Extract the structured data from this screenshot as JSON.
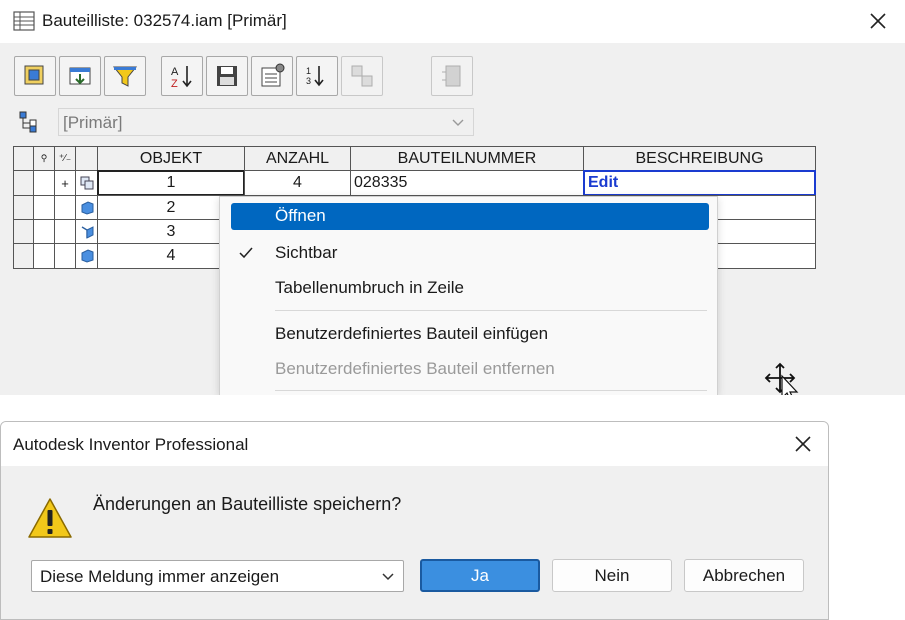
{
  "bom_window": {
    "title": "Bauteilliste: 032574.iam [Primär]",
    "toolbar": [
      {
        "icon": "view-options-icon"
      },
      {
        "icon": "import-icon"
      },
      {
        "icon": "filter-icon"
      },
      {
        "icon": "sort-az-icon"
      },
      {
        "icon": "export-icon"
      },
      {
        "icon": "settings-icon"
      },
      {
        "icon": "renumber-icon"
      },
      {
        "icon": "compare-icon"
      },
      {
        "icon": "structure-icon"
      }
    ],
    "view_select": {
      "value": "[Primär]"
    },
    "grid": {
      "columns": [
        "OBJEKT",
        "ANZAHL",
        "BAUTEILNUMMER",
        "BESCHREIBUNG"
      ],
      "rows": [
        {
          "expander": "+",
          "objekt": "1",
          "anzahl": "4",
          "bauteilnummer": "028335",
          "beschreibung": "Edit"
        },
        {
          "expander": "",
          "objekt": "2",
          "anzahl": "",
          "bauteilnummer": "",
          "beschreibung": ""
        },
        {
          "expander": "",
          "objekt": "3",
          "anzahl": "",
          "bauteilnummer": "",
          "beschreibung": ""
        },
        {
          "expander": "",
          "objekt": "4",
          "anzahl": "",
          "bauteilnummer": "",
          "beschreibung": ""
        }
      ]
    }
  },
  "context_menu": {
    "items": [
      {
        "label": "Öffnen",
        "state": "selected"
      },
      {
        "label": "Sichtbar",
        "state": "checked"
      },
      {
        "label": "Tabellenumbruch in Zeile",
        "state": "normal"
      },
      {
        "label": "Benutzerdefiniertes Bauteil einfügen",
        "state": "normal"
      },
      {
        "label": "Benutzerdefiniertes Bauteil entfernen",
        "state": "disabled"
      }
    ]
  },
  "dialog": {
    "title": "Autodesk Inventor Professional",
    "message": "Änderungen an Bauteilliste speichern?",
    "select_value": "Diese Meldung immer anzeigen",
    "buttons": {
      "yes": "Ja",
      "no": "Nein",
      "cancel": "Abbrechen"
    }
  },
  "colors": {
    "accent": "#0067c0",
    "edit_text": "#1a3bd0",
    "default_button": "#3b8fe0",
    "warning": "#f2c81a"
  }
}
